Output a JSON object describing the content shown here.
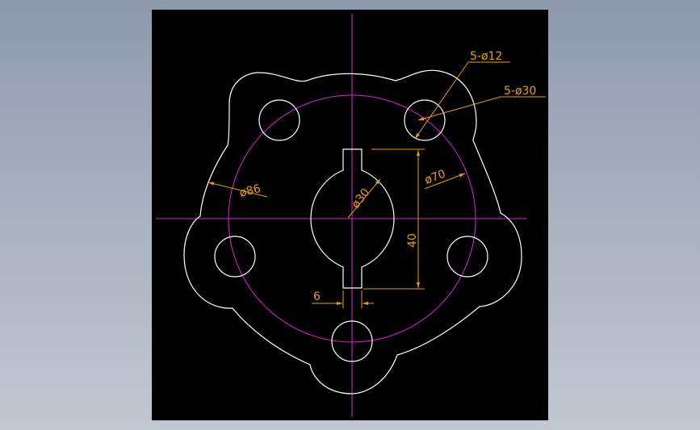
{
  "colors": {
    "page_background": "#a3acbb",
    "canvas": "#000000",
    "geometry": "#ffffff",
    "centerline": "#e020e0",
    "dimension": "#e8a000"
  },
  "labels": {
    "holes_small": "5-ø12",
    "holes_large": "5-ø30",
    "bolt_circle": "ø86",
    "outer_diameter": "ø70",
    "bore": "ø30",
    "keyway_depth": "40",
    "keyway_width": "6"
  }
}
